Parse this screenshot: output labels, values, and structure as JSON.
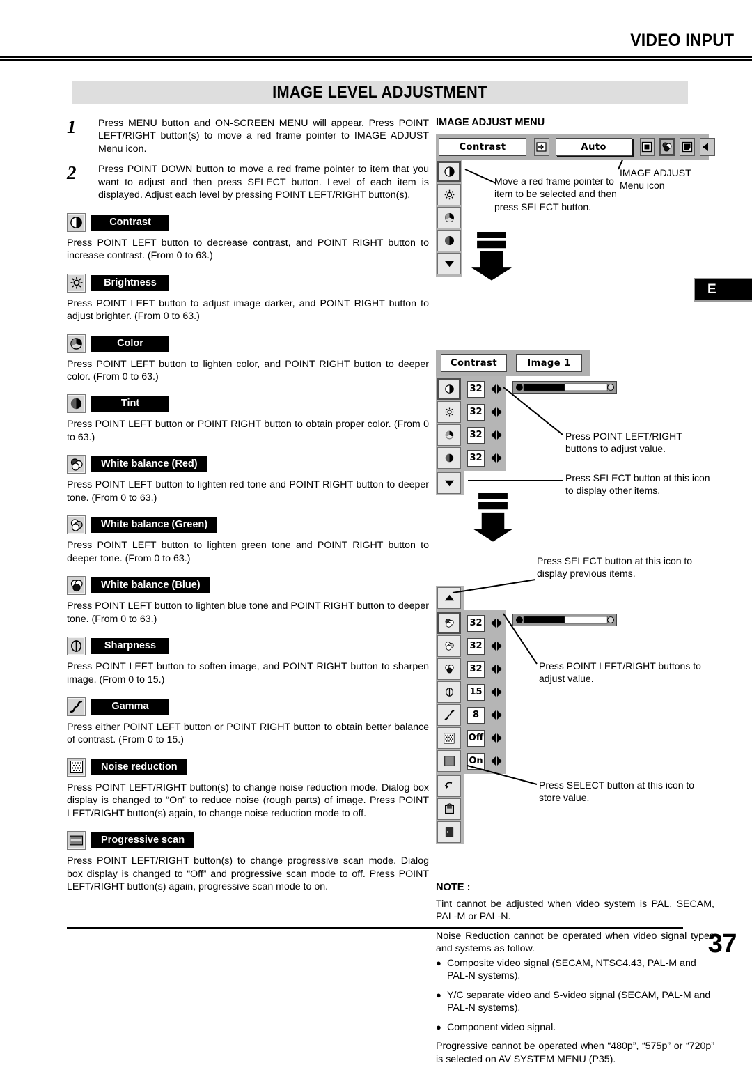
{
  "header": {
    "title": "VIDEO INPUT"
  },
  "section": {
    "title": "IMAGE LEVEL ADJUSTMENT"
  },
  "edge_tab": {
    "label": "E"
  },
  "steps": [
    {
      "num": "1",
      "text": "Press MENU button and ON-SCREEN MENU will appear.  Press POINT LEFT/RIGHT button(s) to move a red frame pointer to IMAGE ADJUST Menu icon."
    },
    {
      "num": "2",
      "text": "Press POINT DOWN button to move a red frame pointer to item that you want to adjust and then press SELECT button.  Level of each item is displayed.  Adjust each level by pressing POINT LEFT/RIGHT button(s)."
    }
  ],
  "items": [
    {
      "icon": "contrast-icon",
      "label": "Contrast",
      "body": "Press POINT LEFT button to decrease contrast, and POINT RIGHT button to increase contrast.  (From 0 to 63.)"
    },
    {
      "icon": "brightness-icon",
      "label": "Brightness",
      "body": "Press POINT LEFT button to adjust image darker, and POINT RIGHT button to adjust brighter.  (From 0 to 63.)"
    },
    {
      "icon": "color-icon",
      "label": "Color",
      "body": "Press POINT LEFT button to lighten color, and POINT RIGHT button to deeper color.  (From 0 to 63.)"
    },
    {
      "icon": "tint-icon",
      "label": "Tint",
      "body": "Press POINT LEFT button or POINT RIGHT button to obtain proper color.  (From 0 to 63.)"
    },
    {
      "icon": "white-balance-red-icon",
      "label": "White balance (Red)",
      "body": "Press POINT LEFT button to lighten red tone and POINT RIGHT button to deeper tone.  (From 0 to 63.)"
    },
    {
      "icon": "white-balance-green-icon",
      "label": "White balance (Green)",
      "body": "Press POINT LEFT button to lighten green tone and POINT RIGHT button to deeper tone.  (From 0 to 63.)"
    },
    {
      "icon": "white-balance-blue-icon",
      "label": "White balance (Blue)",
      "body": "Press POINT LEFT button to lighten blue tone and POINT RIGHT button to deeper tone.  (From 0 to 63.)"
    },
    {
      "icon": "sharpness-icon",
      "label": "Sharpness",
      "body": "Press POINT LEFT button to soften image, and POINT RIGHT button to sharpen image.  (From 0 to 15.)"
    },
    {
      "icon": "gamma-icon",
      "label": "Gamma",
      "body": "Press either POINT LEFT button or POINT RIGHT button to obtain better balance of contrast.  (From 0 to 15.)"
    },
    {
      "icon": "noise-reduction-icon",
      "label": "Noise reduction",
      "body": "Press POINT LEFT/RIGHT button(s) to change noise reduction mode. Dialog box display is changed to “On” to reduce noise (rough parts) of image. Press POINT LEFT/RIGHT button(s) again, to change noise reduction mode to off."
    },
    {
      "icon": "progressive-scan-icon",
      "label": "Progressive scan",
      "body": "Press POINT LEFT/RIGHT button(s) to change progressive scan mode.  Dialog box display is changed to “Off” and progressive scan mode to off. Press POINT LEFT/RIGHT button(s) again, progressive scan mode to on."
    }
  ],
  "menu_adjust": {
    "title": "IMAGE ADJUST MENU",
    "menubar": {
      "selected_item": "Contrast",
      "level_value": "Auto"
    },
    "callout_pointer": "Move a red frame pointer to item to be selected and then press SELECT button.",
    "callout_menu_icon": "IMAGE ADJUST Menu icon"
  },
  "menu_page1": {
    "header_left": "Contrast",
    "header_right": "Image 1",
    "rows": [
      {
        "icon": "contrast-icon",
        "value": "32",
        "selected": true
      },
      {
        "icon": "brightness-icon",
        "value": "32",
        "selected": false
      },
      {
        "icon": "color-icon",
        "value": "32",
        "selected": false
      },
      {
        "icon": "tint-icon",
        "value": "32",
        "selected": false
      }
    ],
    "callout_adjust": "Press POINT LEFT/RIGHT buttons to adjust value.",
    "callout_next": "Press SELECT button at this icon to display other items."
  },
  "menu_page2": {
    "rows": [
      {
        "icon": "white-balance-red-icon",
        "value": "32",
        "selected": true
      },
      {
        "icon": "white-balance-green-icon",
        "value": "32",
        "selected": false
      },
      {
        "icon": "white-balance-blue-icon",
        "value": "32",
        "selected": false
      },
      {
        "icon": "sharpness-icon",
        "value": "15",
        "selected": false
      },
      {
        "icon": "gamma-icon",
        "value": "8",
        "selected": false
      },
      {
        "icon": "noise-reduction-icon",
        "value": "Off",
        "selected": false
      },
      {
        "icon": "progressive-scan-icon",
        "value": "On",
        "selected": false
      }
    ],
    "callout_prev": "Press SELECT button at this icon to display previous items.",
    "callout_adjust": "Press POINT LEFT/RIGHT buttons to adjust value.",
    "callout_store": "Press SELECT button at this icon to store value."
  },
  "note": {
    "title": "NOTE :",
    "p1": "Tint cannot be adjusted when video system is PAL, SECAM, PAL-M or PAL-N.",
    "p2": "Noise Reduction cannot be operated when video signal types and systems as follow.",
    "bullets": [
      "Composite video signal (SECAM, NTSC4.43, PAL-M and PAL-N systems).",
      "Y/C separate video and S-video signal (SECAM, PAL-M and PAL-N systems).",
      "Component video signal."
    ],
    "p3": "Progressive cannot be operated when “480p”, “575p” or “720p” is selected on AV SYSTEM MENU (P35)."
  },
  "footer": {
    "page_number": "37"
  }
}
